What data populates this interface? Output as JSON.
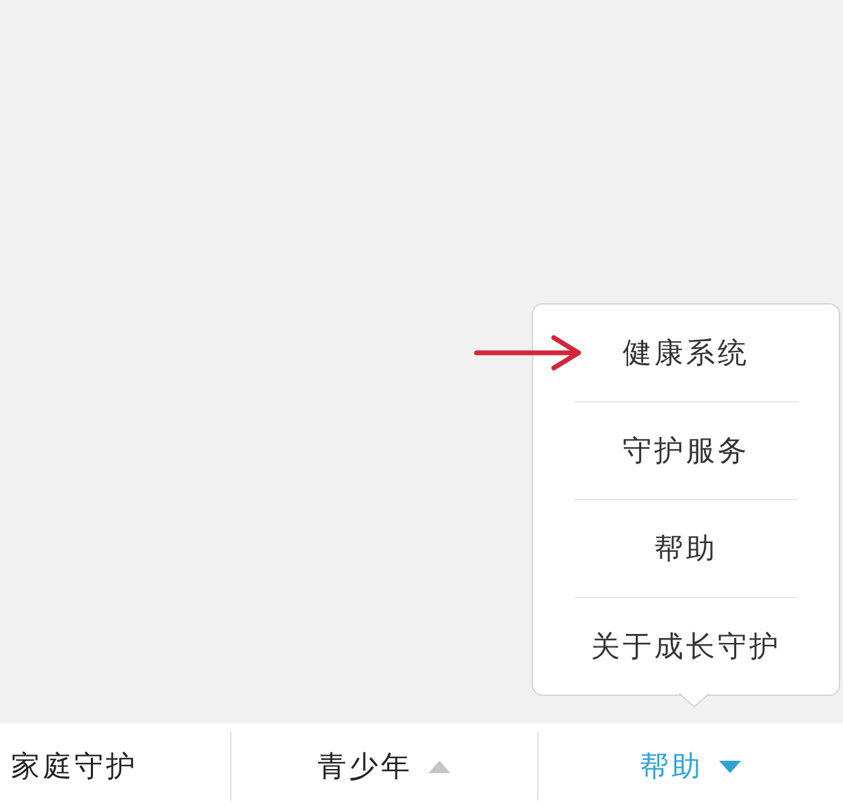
{
  "popup_menu": {
    "items": [
      {
        "label": "健康系统"
      },
      {
        "label": "守护服务"
      },
      {
        "label": "帮助"
      },
      {
        "label": "关于成长守护"
      }
    ]
  },
  "tab_bar": {
    "tabs": [
      {
        "label": "家庭守护",
        "kind": "plain",
        "selected": false
      },
      {
        "label": "青少年",
        "kind": "menu",
        "selected": false,
        "expanded": false
      },
      {
        "label": "帮助",
        "kind": "menu",
        "selected": true,
        "expanded": true
      }
    ]
  }
}
